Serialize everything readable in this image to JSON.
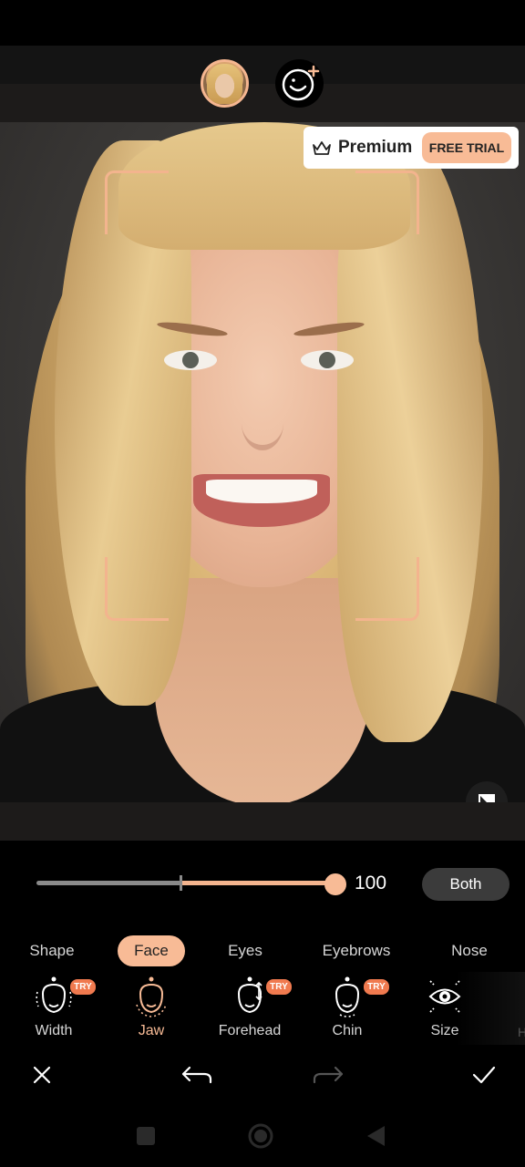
{
  "colors": {
    "accent": "#f8bb96",
    "frame": "#f3b48e",
    "try_badge": "#f07a4f",
    "background": "#000000"
  },
  "header": {
    "face_thumbnail_icon": "face-thumbnail",
    "add_face_icon": "smiley-plus-icon"
  },
  "premium": {
    "icon": "crown-icon",
    "label": "Premium",
    "trial_label": "FREE TRIAL"
  },
  "slider": {
    "value": "100",
    "level": 1.0
  },
  "side_toggle": {
    "label": "Both"
  },
  "tabs": [
    {
      "label": "Shape",
      "active": false
    },
    {
      "label": "Face",
      "active": true
    },
    {
      "label": "Eyes",
      "active": false
    },
    {
      "label": "Eyebrows",
      "active": false
    },
    {
      "label": "Nose",
      "active": false
    }
  ],
  "tools": [
    {
      "label": "Width",
      "icon": "face-width-icon",
      "badge": "TRY",
      "active": false
    },
    {
      "label": "Jaw",
      "icon": "face-jaw-icon",
      "badge": "",
      "active": true
    },
    {
      "label": "Forehead",
      "icon": "face-forehead-icon",
      "badge": "TRY",
      "active": false
    },
    {
      "label": "Chin",
      "icon": "face-chin-icon",
      "badge": "TRY",
      "active": false
    },
    {
      "label": "Size",
      "icon": "eye-size-icon",
      "badge": "",
      "active": false
    }
  ],
  "tools_overflow_hint": "H",
  "actions": {
    "close": "close-icon",
    "undo": "undo-icon",
    "redo": "redo-icon",
    "confirm": "check-icon"
  },
  "navbar": {
    "recents": "square-icon",
    "home": "circle-icon",
    "back": "triangle-back-icon"
  }
}
